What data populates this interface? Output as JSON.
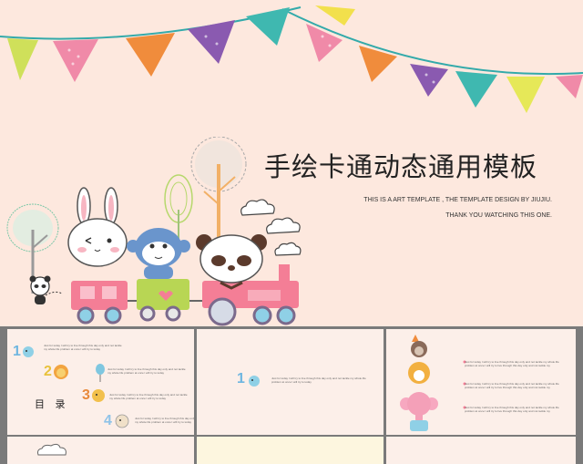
{
  "slide": {
    "title": "手绘卡通动态通用模板",
    "subtitle_line1": "THIS IS A ART TEMPLATE , THE TEMPLATE DESIGN BY JIUJIU.",
    "subtitle_line2": "THANK YOU WATCHING THIS ONE."
  },
  "thumbnails": [
    {
      "heading": "目 录",
      "items": [
        {
          "number": "1",
          "text": "Just for today I will try to live through this day only and not tackle my whole life problem at once I will try to today"
        },
        {
          "number": "2",
          "text": "Just for today I will try to live through this day only and not tackle my whole life problem at once I will try to today"
        },
        {
          "number": "3",
          "text": "Just for today I will try to live through this day only and not tackle my whole life problem at once I will try to today"
        },
        {
          "number": "4",
          "text": "Just for today I will try to live through this day only and not tackle my whole life problem at once I will try to today"
        }
      ]
    },
    {
      "number": "1",
      "text": "Just for today I will try to live through this day only and not tackle my whole life problem at once I will try to today"
    },
    {
      "items": [
        {
          "text": "Just for today I will try to live through this day only and not tackle my whole life problem at once I will try to live through this day only and not tackle my"
        },
        {
          "text": "Just for today I will try to live through this day only and not tackle my whole life problem at once I will try to live through this day only and not tackle my"
        },
        {
          "text": "Just for today I will try to live through this day only and not tackle my whole life problem at once I will try to live through this day only and not tackle my"
        }
      ]
    }
  ],
  "colors": {
    "background": "#fde8de",
    "flag_green": "#cfe05a",
    "flag_pink": "#f08aa8",
    "flag_orange": "#f08c3c",
    "flag_purple": "#8a5ab0",
    "flag_teal": "#3fb8b0",
    "flag_yellow": "#f2e04c",
    "train_pink": "#f47e96",
    "train_green": "#b8d654"
  },
  "icons": [
    "bunting-flags",
    "bunting-flags-right",
    "tree-icon",
    "cloud-icon",
    "rabbit-icon",
    "monkey-icon",
    "panda-icon",
    "train-icon",
    "small-panda-icon"
  ]
}
